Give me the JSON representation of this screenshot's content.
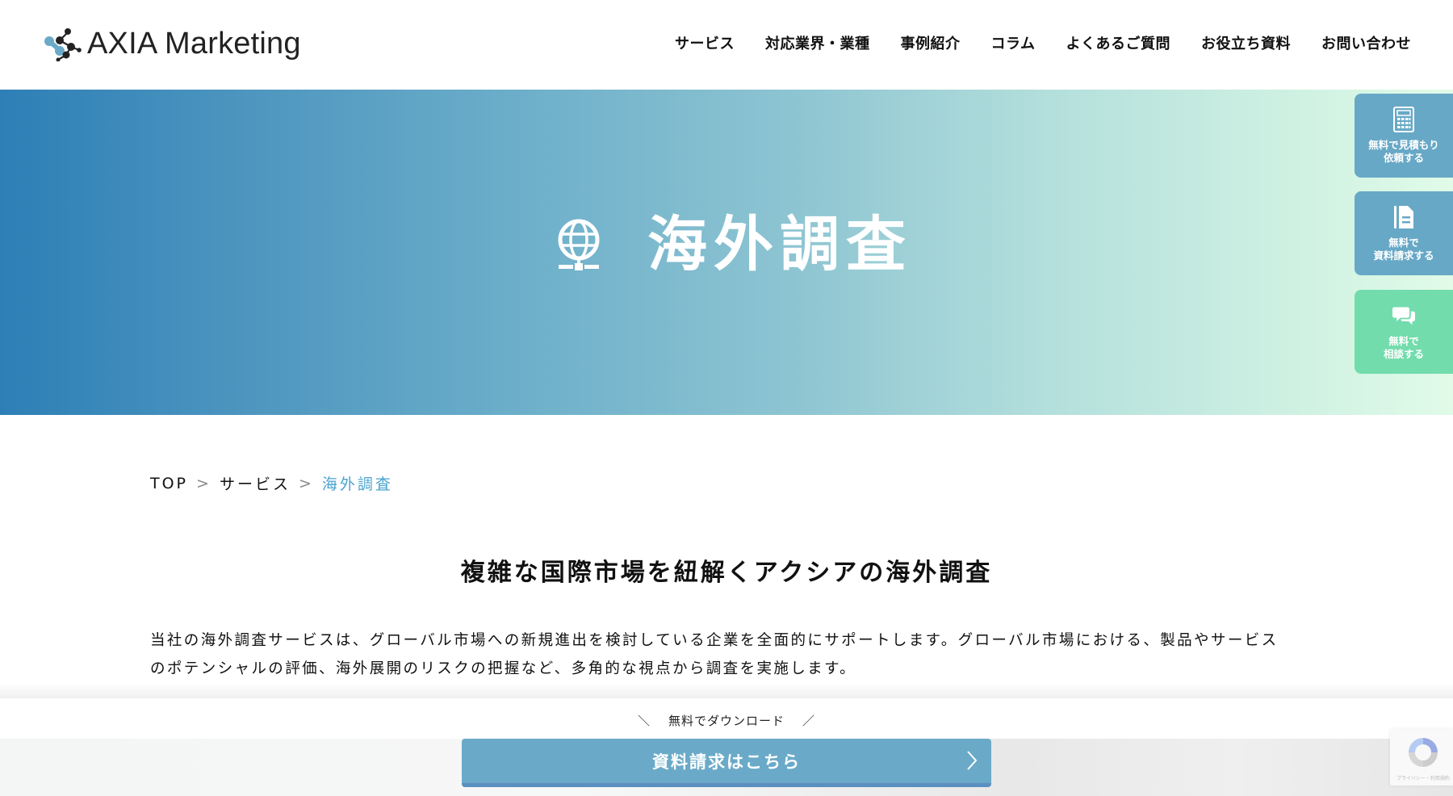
{
  "header": {
    "logo_text": "AXIA Marketing",
    "nav": [
      {
        "label": "サービス"
      },
      {
        "label": "対応業界・業種"
      },
      {
        "label": "事例紹介"
      },
      {
        "label": "コラム"
      },
      {
        "label": "よくあるご質問"
      },
      {
        "label": "お役立ち資料"
      },
      {
        "label": "お問い合わせ"
      }
    ]
  },
  "hero": {
    "icon": "globe-icon",
    "title": "海外調査"
  },
  "side_buttons": [
    {
      "icon": "calculator-icon",
      "label": "無料で見積もり\n依頼する",
      "color": "#67a8c6"
    },
    {
      "icon": "document-icon",
      "label": "無料で\n資料請求する",
      "color": "#67a8c6"
    },
    {
      "icon": "chat-bubbles-icon",
      "label": "無料で\n相談する",
      "color": "#72dcac"
    }
  ],
  "breadcrumb": {
    "items": [
      "TOP",
      "サービス"
    ],
    "separator": ">",
    "current": "海外調査"
  },
  "section": {
    "heading": "複雑な国際市場を紐解くアクシアの海外調査",
    "body_line1": "当社の海外調査サービスは、グローバル市場への新規進出を検討している企業を全面的にサポートします。グローバル市場における、製品やサービス",
    "body_line2": "のポテンシャルの評価、海外展開のリスクの把握など、多角的な視点から調査を実施します。"
  },
  "sticky_cta": {
    "note_left": "＼",
    "note": "無料でダウンロード",
    "note_right": "／",
    "button_label": "資料請求はこちら"
  },
  "recaptcha": {
    "text": "プライバシー・利用規約"
  },
  "colors": {
    "accent_blue": "#6aaac8",
    "breadcrumb_current": "#4aa3d1",
    "consult_green": "#72dcac",
    "hero_start": "#2d7fb6",
    "hero_end": "#e1fbe8"
  }
}
